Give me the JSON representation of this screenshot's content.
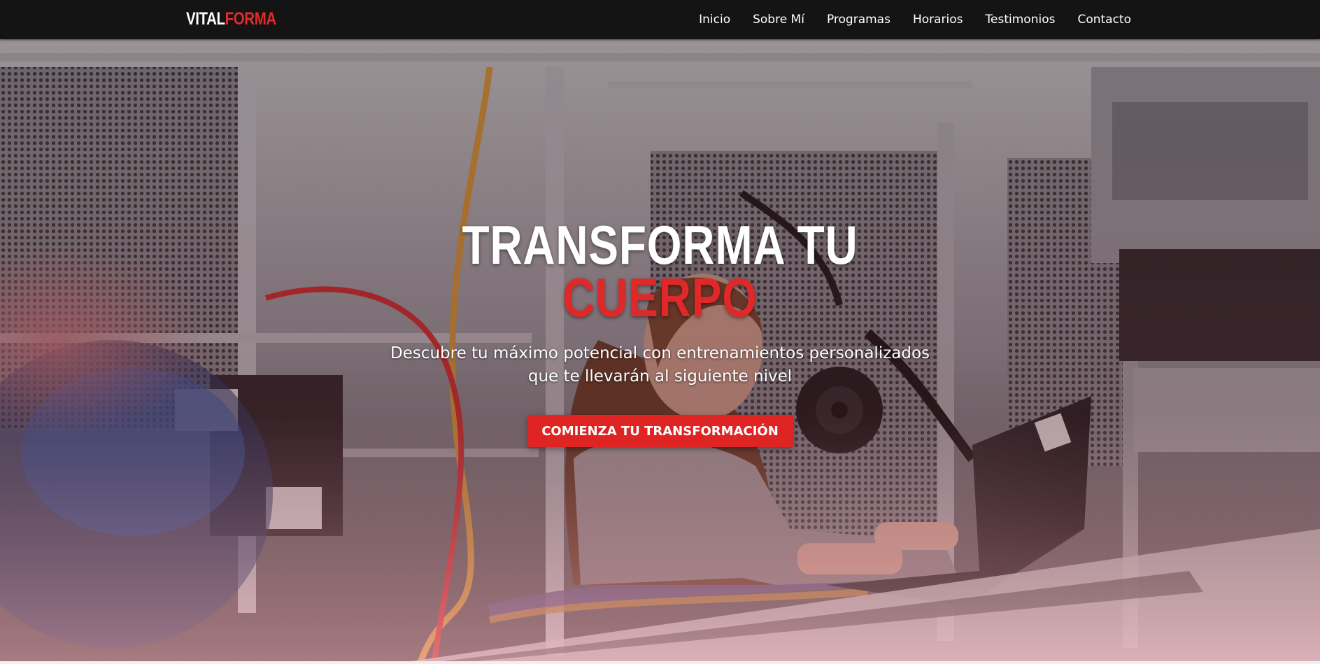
{
  "brand": {
    "part1": "VITAL",
    "part2": "FORMA"
  },
  "nav": {
    "items": [
      {
        "label": "Inicio"
      },
      {
        "label": "Sobre Mí"
      },
      {
        "label": "Programas"
      },
      {
        "label": "Horarios"
      },
      {
        "label": "Testimonios"
      },
      {
        "label": "Contacto"
      }
    ]
  },
  "hero": {
    "title_line1": "TRANSFORMA TU",
    "title_line2": "CUERPO",
    "subtitle_line1": "Descubre tu máximo potencial con entrenamientos personalizados",
    "subtitle_line2": "que te llevarán al siguiente nivel",
    "cta_label": "COMIENZA TU TRANSFORMACIÓN",
    "background_image": "woman working on laptop in electronics lab"
  },
  "colors": {
    "accent": "#e02b2b",
    "navbar_bg": "#141414",
    "text_light": "#ffffff"
  }
}
